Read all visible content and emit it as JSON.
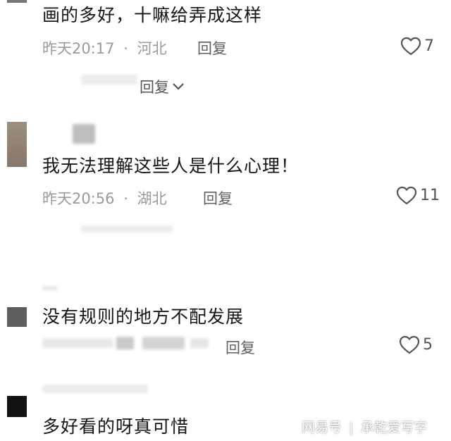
{
  "comments": [
    {
      "text": "画的多好，十嘛给弄成这样",
      "time": "昨天20:17",
      "sep": "·",
      "location": "河北",
      "reply_label": "回复",
      "likes": "7"
    },
    {
      "text": "我无法理解这些人是什么心理！",
      "time": "昨天20:56",
      "sep": "·",
      "location": "湖北",
      "reply_label": "回复",
      "likes": "11"
    },
    {
      "text": "没有规则的地方不配发展",
      "reply_label": "回复",
      "likes": "5"
    },
    {
      "text": "多好看的呀真可惜"
    }
  ],
  "expand_reply": {
    "label": "回复"
  },
  "watermark": {
    "site": "网易号",
    "divider": "|",
    "author": "承乾爱写字"
  },
  "colors": {
    "like_icon": "#555555",
    "meta": "#9a9a9a"
  }
}
